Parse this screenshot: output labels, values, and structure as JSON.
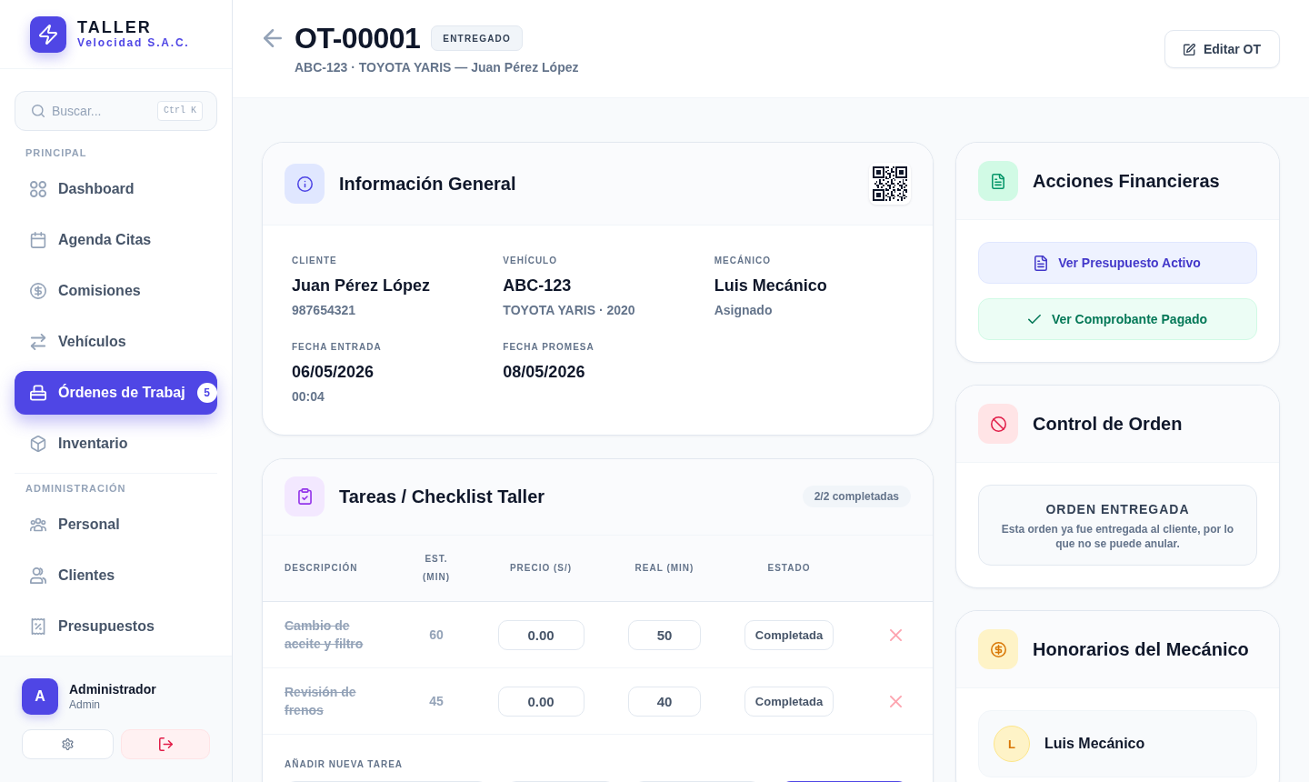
{
  "sidebar": {
    "brand": {
      "title": "TALLER",
      "subtitle": "Velocidad S.A.C."
    },
    "search": {
      "placeholder": "Buscar...",
      "shortcut": "Ctrl K"
    },
    "sections": [
      {
        "label": "PRINCIPAL",
        "items": [
          {
            "label": "Dashboard",
            "selected": false
          },
          {
            "label": "Agenda Citas",
            "selected": false
          },
          {
            "label": "Comisiones",
            "selected": false
          },
          {
            "label": "Vehículos",
            "selected": false
          },
          {
            "label": "Órdenes de Trabaj",
            "selected": true,
            "badge": "5"
          },
          {
            "label": "Inventario",
            "selected": false
          }
        ]
      },
      {
        "label": "ADMINISTRACIÓN",
        "items": [
          {
            "label": "Personal",
            "selected": false
          },
          {
            "label": "Clientes",
            "selected": false
          },
          {
            "label": "Presupuestos",
            "selected": false
          }
        ]
      }
    ],
    "user": {
      "initial": "A",
      "name": "Administrador",
      "role": "Admin"
    }
  },
  "header": {
    "title": "OT-00001",
    "status": "ENTREGADO",
    "subtitle": "ABC-123 · TOYOTA YARIS — Juan Pérez López",
    "edit_button": "Editar OT"
  },
  "general_info": {
    "title": "Información General",
    "fields": [
      {
        "label": "CLIENTE",
        "value": "Juan Pérez López",
        "detail": "987654321"
      },
      {
        "label": "VEHÍCULO",
        "value": "ABC-123",
        "detail": "TOYOTA YARIS · 2020"
      },
      {
        "label": "MECÁNICO",
        "value": "Luis Mecánico",
        "detail": "Asignado"
      },
      {
        "label": "FECHA ENTRADA",
        "value": "06/05/2026",
        "detail": "00:04"
      },
      {
        "label": "FECHA PROMESA",
        "value": "08/05/2026"
      }
    ]
  },
  "tasks": {
    "title": "Tareas / Checklist Taller",
    "summary": "2/2 completadas",
    "columns": [
      "DESCRIPCIÓN",
      "EST. (MIN)",
      "PRECIO (S/)",
      "REAL (MIN)",
      "ESTADO"
    ],
    "rows": [
      {
        "description": "Cambio de aceite y filtro",
        "estimate": "60",
        "price": "0.00",
        "actual": "50",
        "status": "Completada",
        "completed": true
      },
      {
        "description": "Revisión de frenos",
        "estimate": "45",
        "price": "0.00",
        "actual": "40",
        "status": "Completada",
        "completed": true
      }
    ],
    "add_label": "AÑADIR NUEVA TAREA"
  },
  "financial_actions": {
    "title": "Acciones Financieras",
    "buttons": [
      {
        "label": "Ver Presupuesto Activo",
        "kind": "budget"
      },
      {
        "label": "Ver Comprobante Pagado",
        "kind": "receipt"
      }
    ]
  },
  "order_control": {
    "title": "Control de Orden",
    "notice_title": "ORDEN ENTREGADA",
    "notice_text": "Esta orden ya fue entregada al cliente, por lo que no se puede anular."
  },
  "mechanic_fees": {
    "title": "Honorarios del Mecánico",
    "mechanics": [
      {
        "initial": "L",
        "name": "Luis Mecánico"
      }
    ]
  }
}
